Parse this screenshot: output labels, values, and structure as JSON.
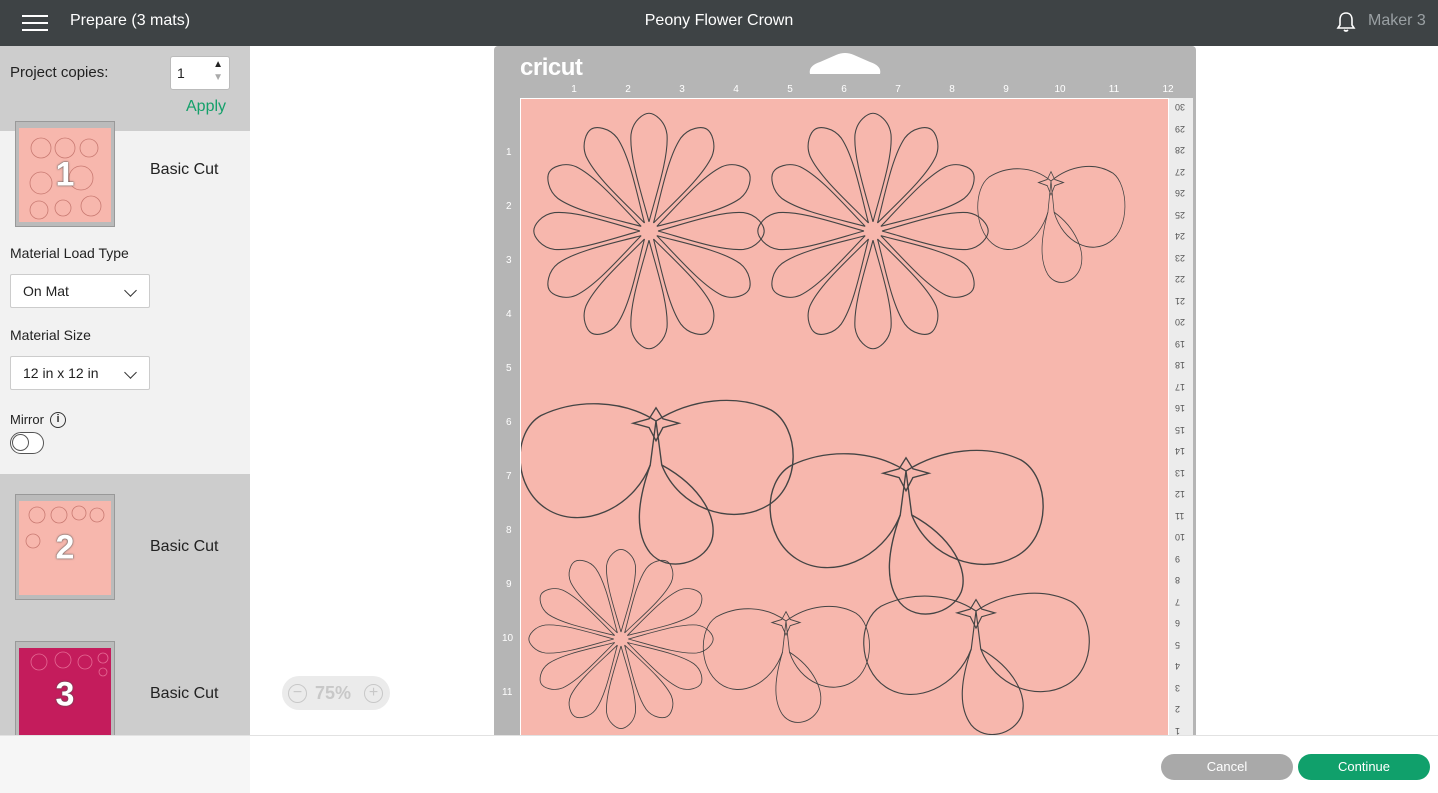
{
  "header": {
    "menu_icon": "hamburger-icon",
    "prepare_title": "Prepare (3 mats)",
    "project_title": "Peony Flower Crown",
    "notification_icon": "bell-icon",
    "machine": "Maker 3"
  },
  "sidebar": {
    "copies_label": "Project copies:",
    "copies_value": "1",
    "apply_label": "Apply",
    "mats": [
      {
        "number": "1",
        "label": "Basic Cut",
        "color": "#f7b7ad"
      },
      {
        "number": "2",
        "label": "Basic Cut",
        "color": "#f7b7ad"
      },
      {
        "number": "3",
        "label": "Basic Cut",
        "color": "#c41c5c"
      }
    ],
    "material_load_type_label": "Material Load Type",
    "material_load_type_value": "On Mat",
    "material_size_label": "Material Size",
    "material_size_value": "12 in x 12 in",
    "mirror_label": "Mirror",
    "mirror_info_icon": "info-icon",
    "mirror_on": false
  },
  "mat": {
    "brand": "cricut",
    "top_ruler": [
      "1",
      "2",
      "3",
      "4",
      "5",
      "6",
      "7",
      "8",
      "9",
      "10",
      "11",
      "12"
    ],
    "left_ruler": [
      "1",
      "2",
      "3",
      "4",
      "5",
      "6",
      "7",
      "8",
      "9",
      "10",
      "11"
    ],
    "right_ruler": [
      "30",
      "29",
      "28",
      "27",
      "26",
      "25",
      "24",
      "23",
      "22",
      "21",
      "20",
      "19",
      "18",
      "17",
      "16",
      "15",
      "14",
      "13",
      "12",
      "11",
      "10",
      "9",
      "8",
      "7",
      "6",
      "5",
      "4",
      "3",
      "2",
      "1"
    ],
    "mat_color": "#f7b7ad"
  },
  "zoom": {
    "value": "75%"
  },
  "footer": {
    "cancel_label": "Cancel",
    "continue_label": "Continue"
  }
}
